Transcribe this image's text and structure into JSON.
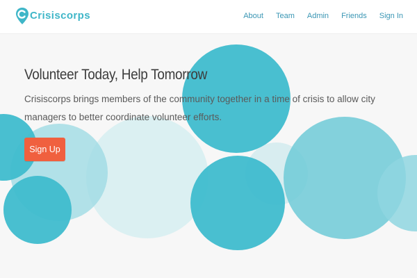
{
  "nav": {
    "brand": "Crisiscorps",
    "links": [
      "About",
      "Team",
      "Admin",
      "Friends",
      "Sign In"
    ]
  },
  "hero": {
    "title": "Volunteer Today, Help Tomorrow",
    "description": "Crisiscorps brings members of the community together in a time of crisis to allow city managers to better coordinate volunteer efforts.",
    "cta_label": "Sign Up"
  },
  "colors": {
    "brand": "#3fb6c8",
    "nav_link": "#3a96b4",
    "cta": "#f0603f",
    "bubble_dark": "#3fbccd",
    "bubble_mid": "#7fd0dc",
    "bubble_light": "#cfeaee"
  },
  "icons": {
    "brand_mark": "map-pin-icon"
  }
}
